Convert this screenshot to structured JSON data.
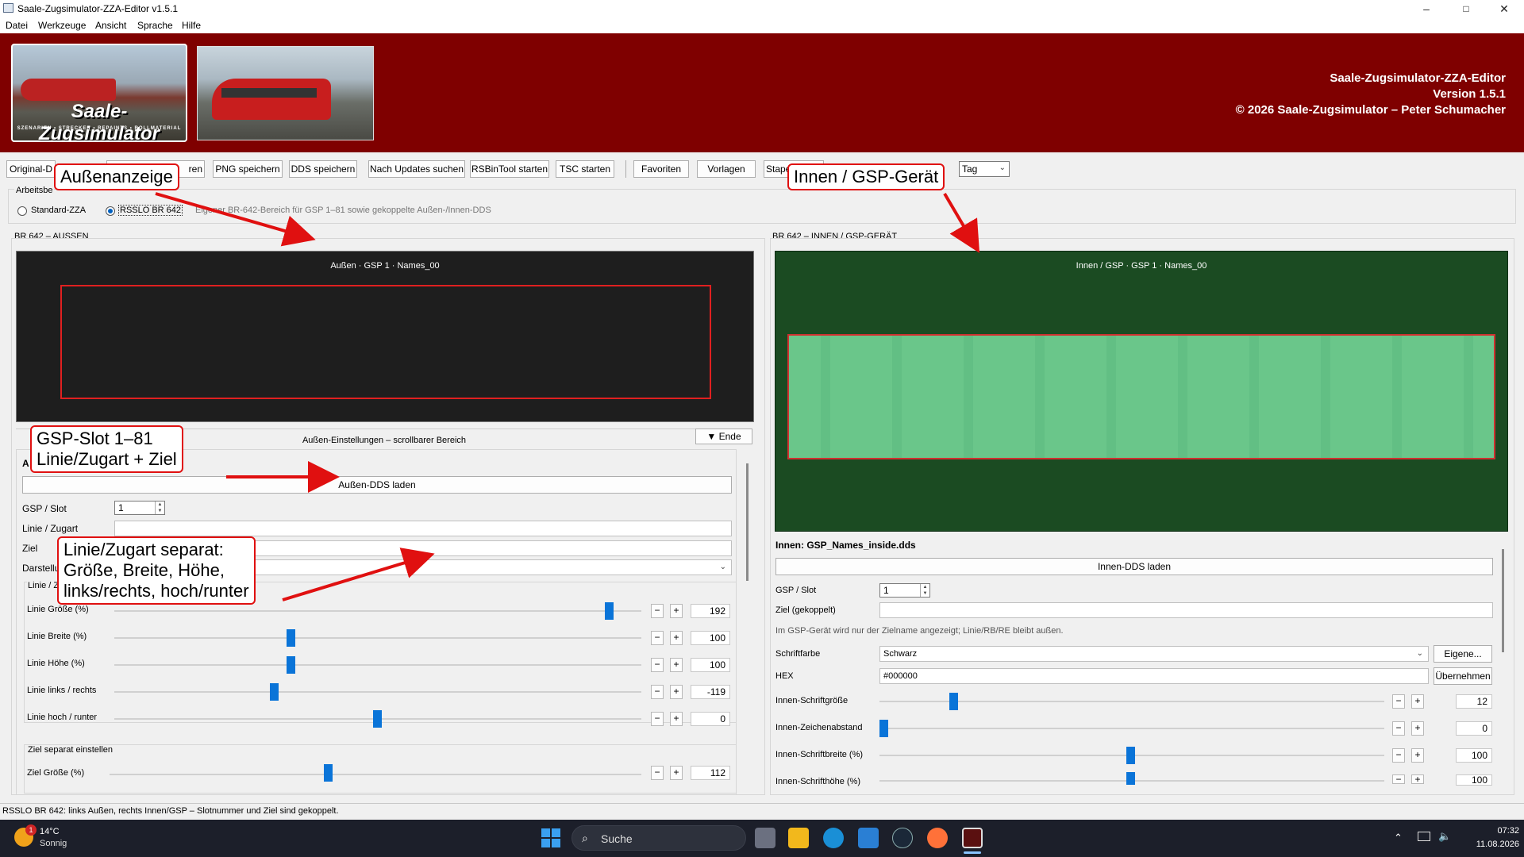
{
  "window": {
    "title": "Saale-Zugsimulator-ZZA-Editor v1.5.1",
    "controls": {
      "minimize": "–",
      "maximize": "□",
      "close": "✕"
    }
  },
  "menu": [
    "Datei",
    "Werkzeuge",
    "Ansicht",
    "Sprache",
    "Hilfe"
  ],
  "header": {
    "logo_title": "Saale-Zugsimulator",
    "logo_subtitle": "SZENARIEN • STRECKEN • REPAINTS • ROLLMATERIAL",
    "line1": "Saale-Zugsimulator-ZZA-Editor",
    "line2": "Version 1.5.1",
    "line3": "© 2026 Saale-Zugsimulator – Peter Schumacher"
  },
  "toolbar": {
    "buttons": [
      "Original-D",
      "ren",
      "PNG speichern",
      "DDS speichern",
      "Nach Updates suchen",
      "RSBinTool starten",
      "TSC starten",
      "Favoriten",
      "Vorlagen",
      "Stape"
    ],
    "mode_select": "Tag"
  },
  "arbeitsbereich": {
    "label": "Arbeitsbe",
    "option1": "Standard-ZZA",
    "option2": "RSSLO BR 642",
    "description": "Eigener BR-642-Bereich für GSP 1–81 sowie gekoppelte Außen-/Innen-DDS"
  },
  "left": {
    "section_title": "BR 642 – AUSSEN",
    "preview_caption": "Außen · GSP 1 · Names_00",
    "settings_title": "Außen-Einstellungen – scrollbarer Bereich",
    "end_button": "▼ Ende",
    "group_letter": "A",
    "load_button": "Außen-DDS laden",
    "slot_label": "GSP / Slot",
    "slot_value": "1",
    "linie_label": "Linie / Zugart",
    "ziel_label": "Ziel",
    "darstellung_label": "Darstellu",
    "group_label": "Linie / Z",
    "sliders": [
      {
        "label": "Linie Größe (%)",
        "value": "192"
      },
      {
        "label": "Linie Breite (%)",
        "value": "100"
      },
      {
        "label": "Linie Höhe (%)",
        "value": "100"
      },
      {
        "label": "Linie links / rechts",
        "value": "-119"
      },
      {
        "label": "Linie hoch / runter",
        "value": "0"
      }
    ],
    "ziel_group_label": "Ziel separat einstellen",
    "ziel_slider": {
      "label": "Ziel Größe (%)",
      "value": "112"
    }
  },
  "right": {
    "section_title": "BR 642 – INNEN / GSP-GERÄT",
    "preview_caption": "Innen / GSP · GSP 1 · Names_00",
    "file_label": "Innen: GSP_Names_inside.dds",
    "load_button": "Innen-DDS laden",
    "slot_label": "GSP / Slot",
    "slot_value": "1",
    "ziel_label": "Ziel (gekoppelt)",
    "hint": "Im GSP-Gerät wird nur der Zielname angezeigt; Linie/RB/RE bleibt außen.",
    "color_label": "Schriftfarbe",
    "color_value": "Schwarz",
    "own_button": "Eigene...",
    "hex_label": "HEX",
    "hex_value": "#000000",
    "apply_button": "Übernehmen",
    "sliders": [
      {
        "label": "Innen-Schriftgröße",
        "value": "12"
      },
      {
        "label": "Innen-Zeichenabstand",
        "value": "0"
      },
      {
        "label": "Innen-Schriftbreite (%)",
        "value": "100"
      },
      {
        "label": "Innen-Schrifthöhe (%)",
        "value": "100"
      }
    ]
  },
  "status": "RSSLO BR 642: links Außen, rechts Innen/GSP – Slotnummer und Ziel sind gekoppelt.",
  "annotations": {
    "a1": "Außenanzeige",
    "a2": "Innen / GSP-Gerät",
    "a3_l1": "GSP-Slot 1–81",
    "a3_l2": "Linie/Zugart + Ziel",
    "a4_l1": "Linie/Zugart separat:",
    "a4_l2": "Größe, Breite, Höhe,",
    "a4_l3": "links/rechts, hoch/runter"
  },
  "taskbar": {
    "weather_temp": "14°C",
    "weather_desc": "Sonnig",
    "weather_badge": "1",
    "search": "Suche",
    "time": "07:32",
    "date": "11.08.2026"
  },
  "colors": {
    "header_bg": "#7f0000",
    "accent": "#0a74d8",
    "annotation": "#e01010",
    "inside_preview_bg": "#1b4b22"
  }
}
